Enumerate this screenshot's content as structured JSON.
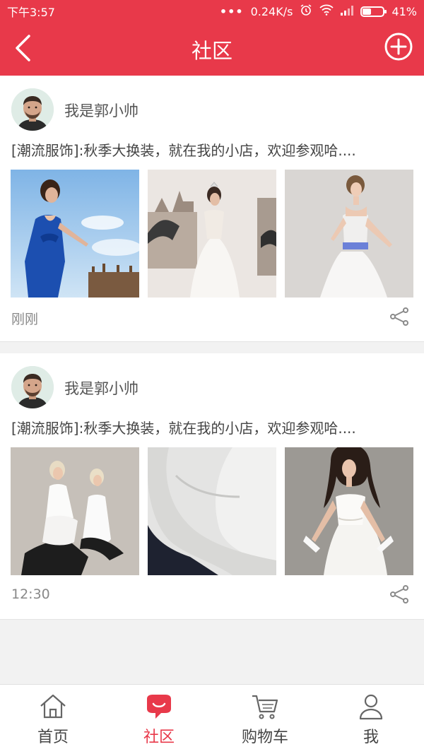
{
  "status_bar": {
    "time": "下午3:57",
    "dots": "•••",
    "network_speed": "0.24K/s",
    "battery": "41%"
  },
  "header": {
    "title": "社区"
  },
  "posts": [
    {
      "username": "我是郭小帅",
      "text": "[潮流服饰]:秋季大换装，就在我的小店，欢迎参观哈....",
      "timestamp": "刚刚"
    },
    {
      "username": "我是郭小帅",
      "text": "[潮流服饰]:秋季大换装，就在我的小店，欢迎参观哈....",
      "timestamp": "12:30"
    }
  ],
  "nav": {
    "home": "首页",
    "community": "社区",
    "cart": "购物车",
    "me": "我"
  },
  "colors": {
    "accent": "#e8394a"
  }
}
